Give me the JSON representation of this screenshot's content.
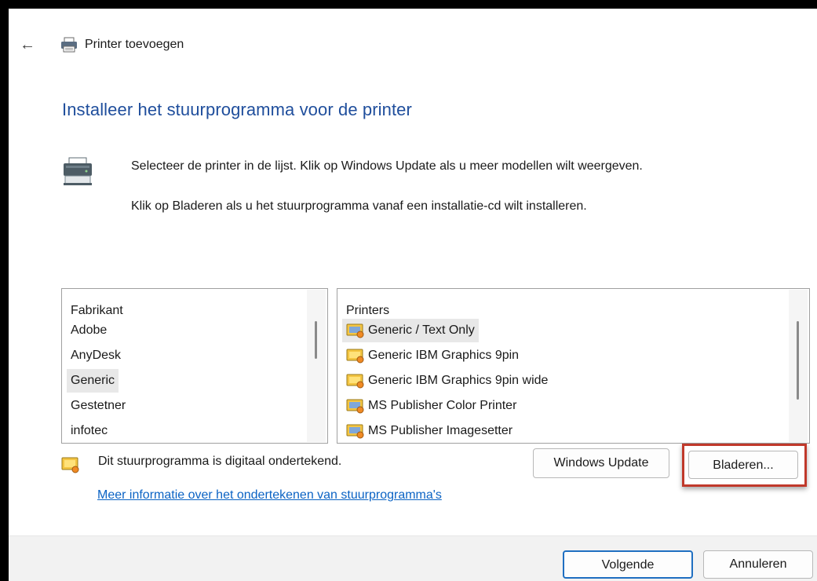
{
  "window": {
    "title": "Printer toevoegen",
    "back_icon": "back-arrow-icon"
  },
  "heading": "Installeer het stuurprogramma voor de printer",
  "description": {
    "line1": "Selecteer de printer in de lijst. Klik op Windows Update als u meer modellen wilt weergeven.",
    "line2": "Klik op Bladeren als u het stuurprogramma vanaf een installatie-cd wilt installeren."
  },
  "manufacturer_list": {
    "header": "Fabrikant",
    "items": [
      "Adobe",
      "AnyDesk",
      "Generic",
      "Gestetner",
      "infotec"
    ],
    "selected": "Generic"
  },
  "printer_list": {
    "header": "Printers",
    "items": [
      "Generic / Text Only",
      "Generic IBM Graphics 9pin",
      "Generic IBM Graphics 9pin wide",
      "MS Publisher Color Printer",
      "MS Publisher Imagesetter"
    ],
    "selected": "Generic / Text Only"
  },
  "signature": {
    "text": "Dit stuurprogramma is digitaal ondertekend.",
    "icon": "certificate-icon"
  },
  "buttons": {
    "windows_update": "Windows Update",
    "browse": "Bladeren...",
    "next": "Volgende",
    "cancel": "Annuleren"
  },
  "more_info_link": "Meer informatie over het ondertekenen van stuurprogramma's",
  "colors": {
    "heading": "#1f4e9c",
    "link": "#0b63c4",
    "highlight": "#c0392b",
    "default_button_border": "#1f6fc1"
  }
}
